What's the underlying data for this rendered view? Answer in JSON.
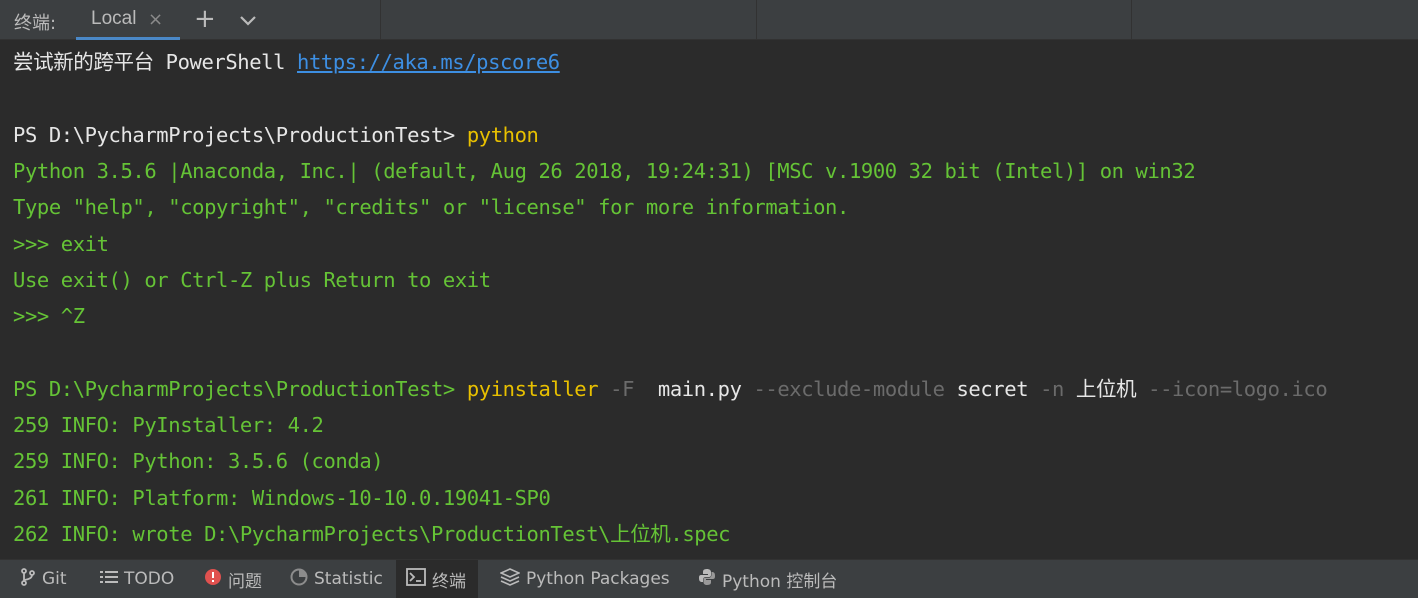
{
  "tabbar": {
    "title": "终端:",
    "tab_label": "Local",
    "close_glyph": "×",
    "add_glyph": "+",
    "menu_icon": "chevron-down-icon"
  },
  "terminal": {
    "lines": [
      {
        "segments": [
          {
            "text": "尝试新的跨平台 PowerShell ",
            "style": "white"
          },
          {
            "text": "https://aka.ms/pscore6",
            "style": "link"
          }
        ]
      },
      {
        "segments": []
      },
      {
        "segments": [
          {
            "text": "PS D:\\PycharmProjects\\ProductionTest> ",
            "style": "white"
          },
          {
            "text": "python",
            "style": "yellow"
          }
        ]
      },
      {
        "segments": [
          {
            "text": "Python 3.5.6 |Anaconda, Inc.| (default, Aug 26 2018, 19:24:31) [MSC v.1900 32 bit (Intel)] on win32",
            "style": "green"
          }
        ]
      },
      {
        "segments": [
          {
            "text": "Type \"help\", \"copyright\", \"credits\" or \"license\" for more information.",
            "style": "green"
          }
        ]
      },
      {
        "segments": [
          {
            "text": ">>> exit",
            "style": "green"
          }
        ]
      },
      {
        "segments": [
          {
            "text": "Use exit() or Ctrl-Z plus Return to exit",
            "style": "green"
          }
        ]
      },
      {
        "segments": [
          {
            "text": ">>> ^Z",
            "style": "green"
          }
        ]
      },
      {
        "segments": []
      },
      {
        "segments": [
          {
            "text": "PS D:\\PycharmProjects\\ProductionTest> ",
            "style": "green"
          },
          {
            "text": "pyinstaller",
            "style": "yellow"
          },
          {
            "text": " -F ",
            "style": "gray"
          },
          {
            "text": " main.py",
            "style": "white"
          },
          {
            "text": " --exclude-module ",
            "style": "gray"
          },
          {
            "text": "secret",
            "style": "white"
          },
          {
            "text": " -n ",
            "style": "gray"
          },
          {
            "text": "上位机",
            "style": "white"
          },
          {
            "text": " --icon=logo.ico",
            "style": "gray"
          }
        ]
      },
      {
        "segments": [
          {
            "text": "259 INFO: PyInstaller: 4.2",
            "style": "green"
          }
        ]
      },
      {
        "segments": [
          {
            "text": "259 INFO: Python: 3.5.6 (conda)",
            "style": "green"
          }
        ]
      },
      {
        "segments": [
          {
            "text": "261 INFO: Platform: Windows-10-10.0.19041-SP0",
            "style": "green"
          }
        ]
      },
      {
        "segments": [
          {
            "text": "262 INFO: wrote D:\\PycharmProjects\\ProductionTest\\上位机.spec",
            "style": "green"
          }
        ]
      }
    ]
  },
  "bottombar": {
    "items": [
      {
        "label": "Git",
        "icon": "git-branch-icon",
        "active": false
      },
      {
        "label": "TODO",
        "icon": "list-icon",
        "active": false
      },
      {
        "label": "问题",
        "icon": "error-icon",
        "active": false
      },
      {
        "label": "Statistic",
        "icon": "statistic-icon",
        "active": false
      },
      {
        "label": "终端",
        "icon": "terminal-icon",
        "active": true
      },
      {
        "label": "Python Packages",
        "icon": "layers-icon",
        "active": false
      },
      {
        "label": "Python 控制台",
        "icon": "python-icon",
        "active": false
      }
    ]
  },
  "colors": {
    "background": "#2b2b2b",
    "toolbar": "#3c3f41",
    "accent": "#4a88c7",
    "green": "#65c336",
    "yellow": "#e8c000",
    "link": "#3d8fe3"
  }
}
